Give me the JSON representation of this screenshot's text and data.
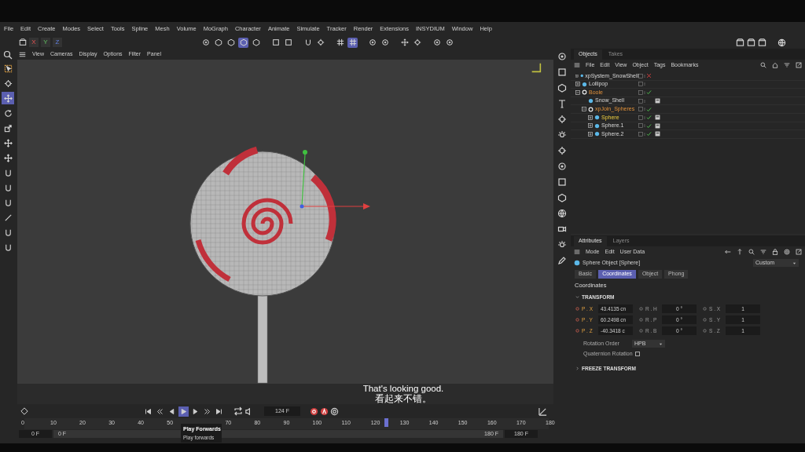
{
  "menu": [
    "File",
    "Edit",
    "Create",
    "Modes",
    "Select",
    "Tools",
    "Spline",
    "Mesh",
    "Volume",
    "MoGraph",
    "Character",
    "Animate",
    "Simulate",
    "Tracker",
    "Render",
    "Extensions",
    "INSYDIUM",
    "Window",
    "Help"
  ],
  "axis_buttons": [
    "X",
    "Y",
    "Z"
  ],
  "toolbar": [
    {
      "selected": false
    },
    {
      "selected": false
    },
    {
      "selected": false
    },
    {
      "selected": true
    },
    {
      "selected": false
    },
    {
      "selected": false
    },
    {
      "selected": false
    },
    {
      "selected": false
    },
    {
      "selected": false
    },
    {
      "selected": false
    },
    {
      "selected": true
    },
    {
      "selected": false
    },
    {
      "selected": false
    },
    {
      "selected": false
    },
    {
      "selected": false
    },
    {
      "selected": false
    },
    {
      "selected": false
    }
  ],
  "left_tools": [
    {
      "selected": false
    },
    {
      "selected": false
    },
    {
      "selected": true
    },
    {
      "selected": false
    },
    {
      "selected": false
    },
    {
      "selected": false
    },
    {
      "selected": false
    },
    {
      "selected": false
    },
    {
      "selected": false
    },
    {
      "selected": false
    },
    {
      "selected": false
    },
    {
      "selected": false
    },
    {
      "selected": false
    }
  ],
  "viewport_menu": [
    "View",
    "Cameras",
    "Display",
    "Options",
    "Filter",
    "Panel"
  ],
  "subtitles": [
    "That's looking good.",
    "看起来不错。"
  ],
  "objects_panel": {
    "tabs": [
      {
        "label": "Objects",
        "selected": true
      },
      {
        "label": "Takes",
        "selected": false
      }
    ],
    "menu": [
      "File",
      "Edit",
      "View",
      "Object",
      "Tags",
      "Bookmarks"
    ],
    "tree": [
      {
        "name": "xpSystem_SnowShell",
        "kind": "object",
        "selected": false,
        "enabled": false,
        "expanded": false
      },
      {
        "name": "Lollipop",
        "kind": "object",
        "selected": false,
        "expanded": false
      },
      {
        "name": "Boole",
        "kind": "generator",
        "selected": false,
        "enabled": true,
        "expanded": true,
        "children": [
          {
            "name": "Snow_Shell",
            "kind": "object",
            "selected": false,
            "tag": true
          },
          {
            "name": "xpJoin_Spheres",
            "kind": "generator",
            "selected": false,
            "enabled": true,
            "expanded": true,
            "children": [
              {
                "name": "Sphere",
                "kind": "object",
                "selected": true,
                "enabled": true,
                "tag": true,
                "expanded": false
              },
              {
                "name": "Sphere.1",
                "kind": "object",
                "selected": false,
                "enabled": true,
                "tag": true,
                "expanded": false
              },
              {
                "name": "Sphere.2",
                "kind": "object",
                "selected": false,
                "enabled": true,
                "tag": true,
                "expanded": false
              }
            ]
          }
        ]
      }
    ]
  },
  "attributes_panel": {
    "tabs": [
      {
        "label": "Attributes",
        "selected": true
      },
      {
        "label": "Layers",
        "selected": false
      }
    ],
    "menu": [
      "Mode",
      "Edit",
      "User Data"
    ],
    "object_title": "Sphere Object [Sphere]",
    "preset": "Custom",
    "sub_tabs": [
      {
        "label": "Basic",
        "selected": false
      },
      {
        "label": "Coordinates",
        "selected": true
      },
      {
        "label": "Object",
        "selected": false
      },
      {
        "label": "Phong",
        "selected": false
      }
    ],
    "section": "Coordinates",
    "groups": [
      {
        "title": "TRANSFORM",
        "expanded": true
      },
      {
        "title": "FREEZE TRANSFORM",
        "expanded": false
      }
    ],
    "fields": [
      [
        {
          "label": "P . X",
          "value": "43.4135 cn",
          "keyed": true
        },
        {
          "label": "R . H",
          "value": "0 °",
          "keyed": false
        },
        {
          "label": "S . X",
          "value": "1",
          "keyed": false
        }
      ],
      [
        {
          "label": "P . Y",
          "value": "60.2498 cn",
          "keyed": true
        },
        {
          "label": "R . P",
          "value": "0 °",
          "keyed": false
        },
        {
          "label": "S . Y",
          "value": "1",
          "keyed": false
        }
      ],
      [
        {
          "label": "P . Z",
          "value": "-40.3418 c",
          "keyed": true
        },
        {
          "label": "R . B",
          "value": "0 °",
          "keyed": false
        },
        {
          "label": "S . Z",
          "value": "1",
          "keyed": false
        }
      ]
    ],
    "rotation_order": {
      "label": "Rotation Order",
      "value": "HPB"
    },
    "quaternion": {
      "label": "Quaternion Rotation",
      "checked": false
    }
  },
  "timeline": {
    "current_frame": "124 F",
    "buttons": [
      {
        "selected": false
      },
      {
        "selected": false
      },
      {
        "selected": false
      },
      {
        "selected": true
      },
      {
        "selected": false
      },
      {
        "selected": false
      },
      {
        "selected": false
      }
    ],
    "ruler_labels": [
      "0",
      "10",
      "20",
      "30",
      "40",
      "50",
      "70",
      "80",
      "90",
      "100",
      "110",
      "120",
      "130",
      "140",
      "150",
      "160",
      "170",
      "180"
    ],
    "playhead": {
      "level": 0.689
    },
    "start": "0 F",
    "range_start": "0 F",
    "range_end": "180 F",
    "end": "180 F",
    "tooltip": {
      "title": "Play Forwards",
      "text": "Play forwards"
    }
  }
}
